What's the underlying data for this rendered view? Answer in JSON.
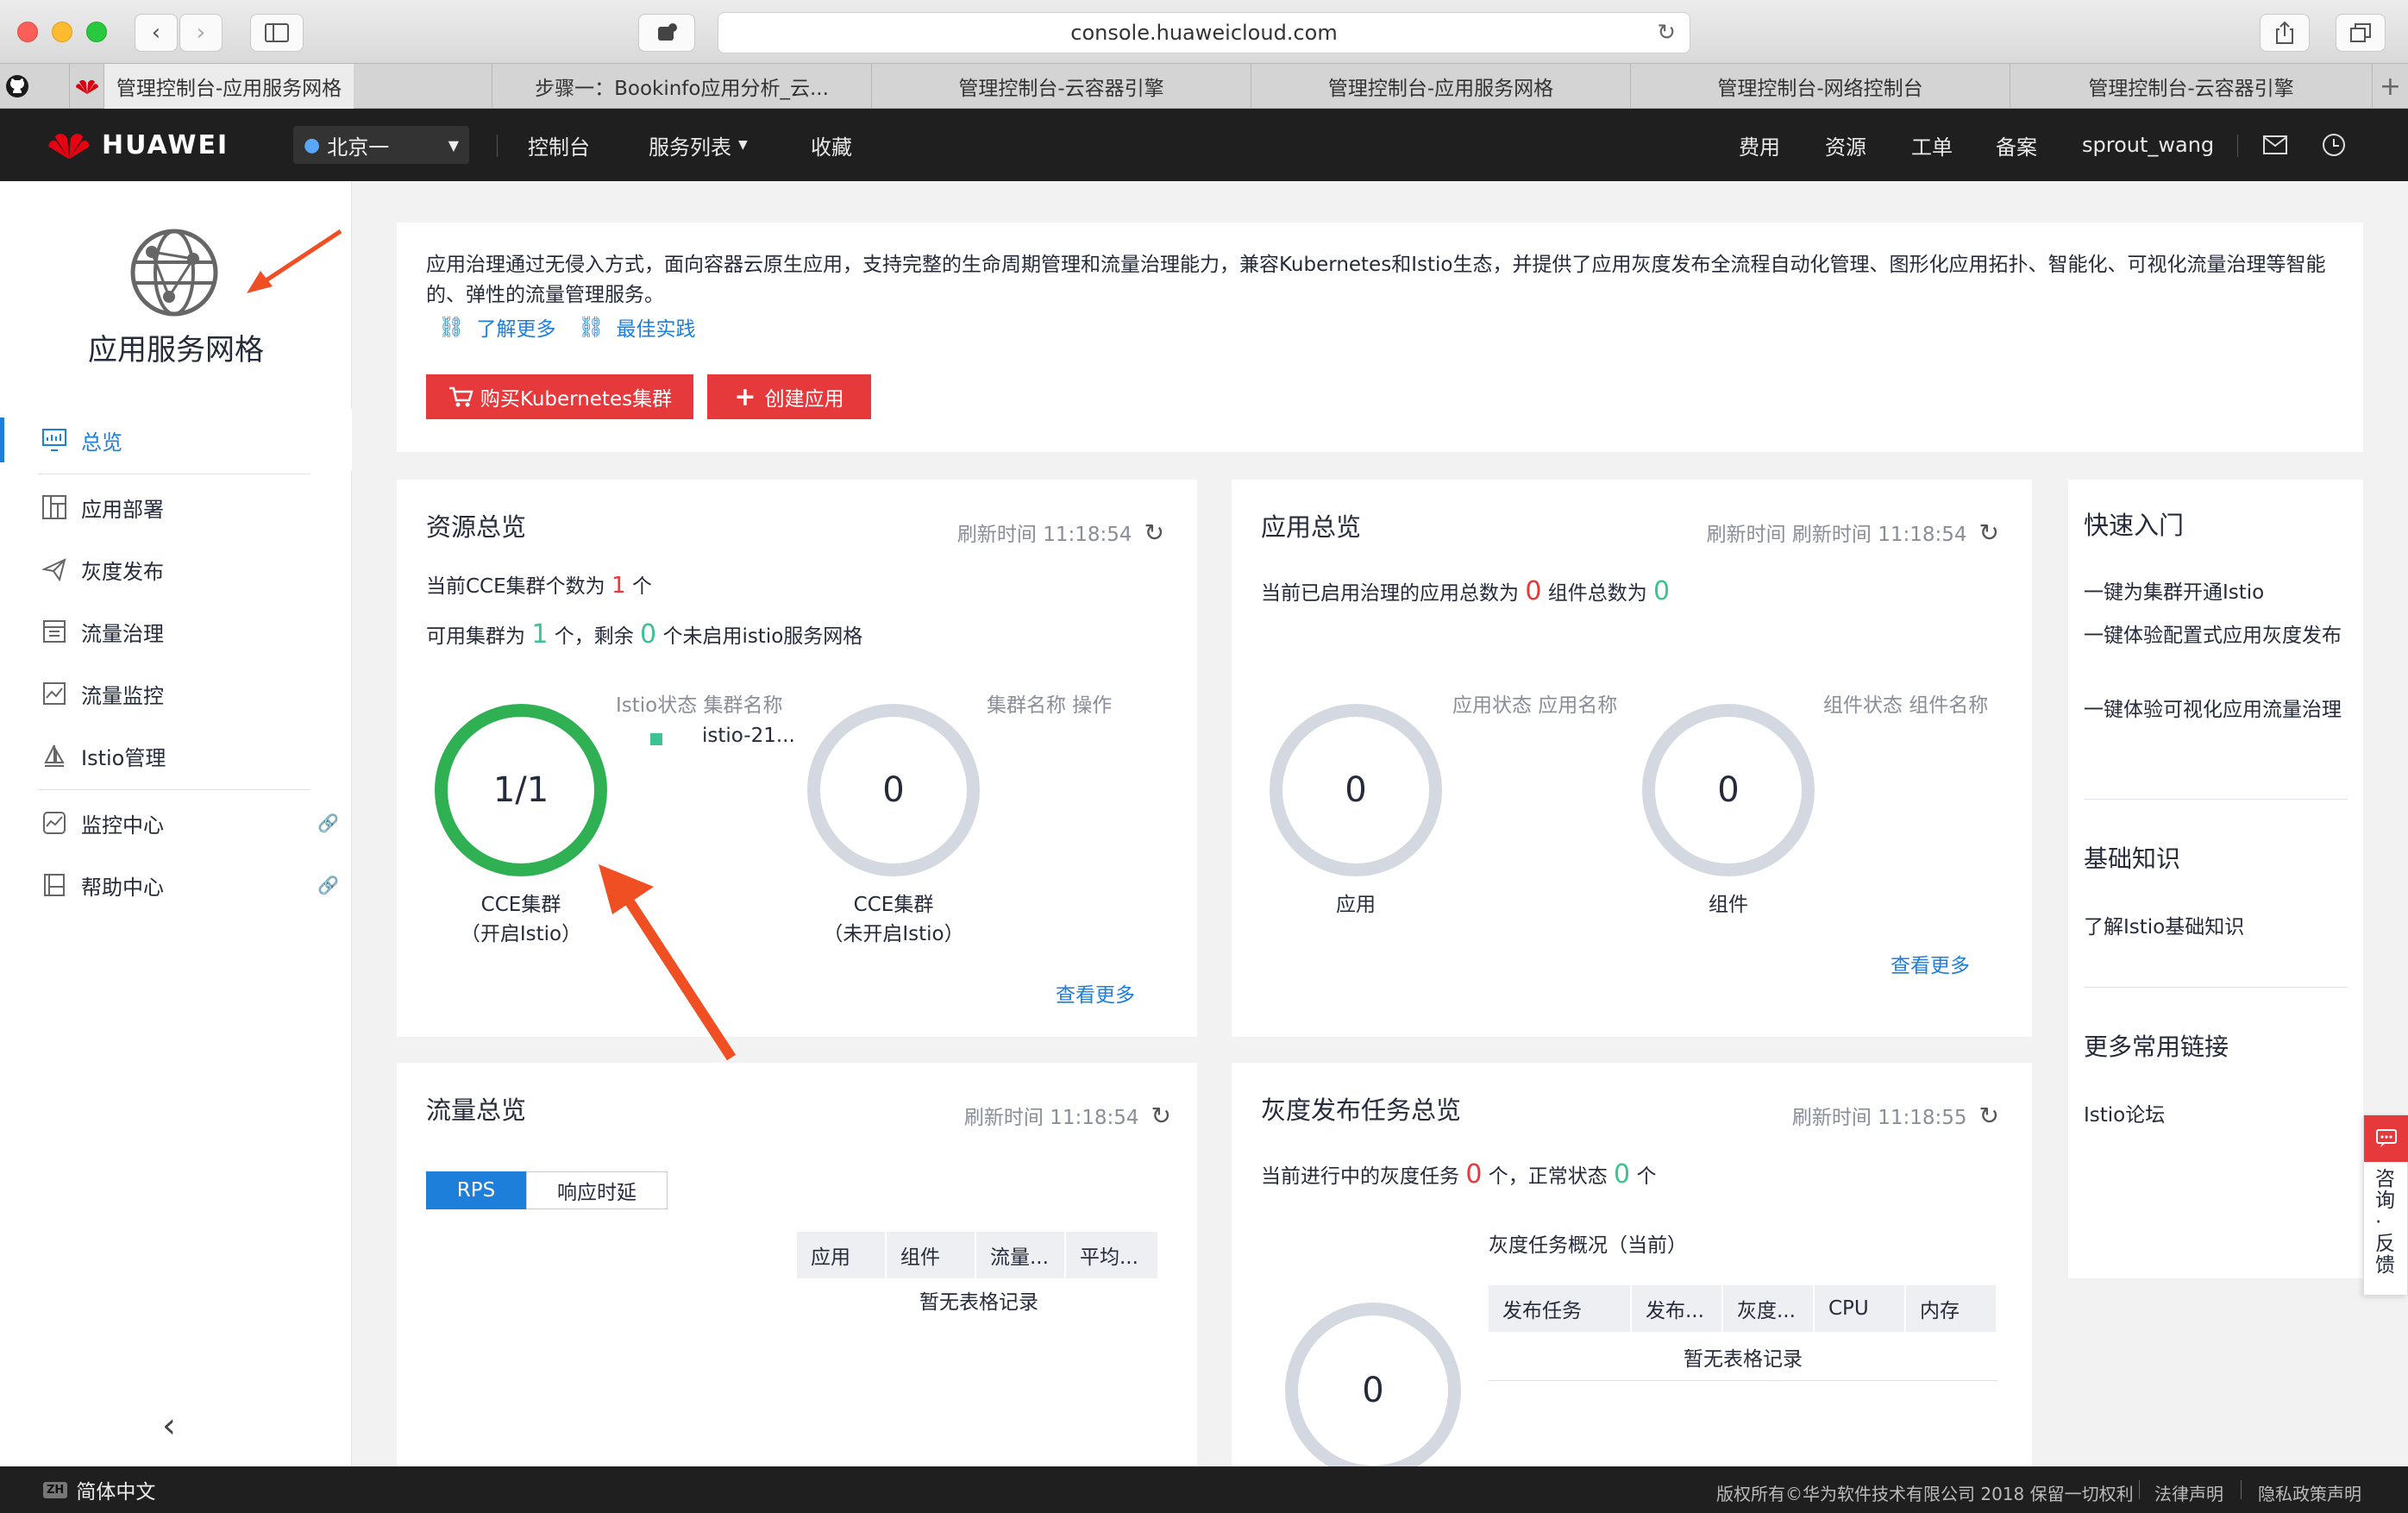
{
  "browser": {
    "url": "console.huaweicloud.com",
    "tabs": [
      {
        "label": "管理控制台-应用服务网格",
        "active": true
      },
      {
        "label": "步骤一：Bookinfo应用分析_云..."
      },
      {
        "label": "管理控制台-云容器引擎"
      },
      {
        "label": "管理控制台-应用服务网格"
      },
      {
        "label": "管理控制台-网络控制台"
      },
      {
        "label": "管理控制台-云容器引擎"
      }
    ],
    "new_tab": "+"
  },
  "header": {
    "brand": "HUAWEI",
    "region": "北京一",
    "nav": [
      "控制台",
      "服务列表",
      "收藏"
    ],
    "right": [
      "费用",
      "资源",
      "工单",
      "备案"
    ],
    "user": "sprout_wang"
  },
  "sidebar": {
    "service_name": "应用服务网格",
    "items": [
      {
        "label": "总览",
        "icon": "overview-icon",
        "active": true
      },
      {
        "label": "应用部署",
        "icon": "deploy-icon"
      },
      {
        "label": "灰度发布",
        "icon": "paper-plane-icon"
      },
      {
        "label": "流量治理",
        "icon": "traffic-gov-icon"
      },
      {
        "label": "流量监控",
        "icon": "traffic-monitor-icon"
      },
      {
        "label": "Istio管理",
        "icon": "istio-icon"
      },
      {
        "label": "监控中心",
        "icon": "monitor-center-icon",
        "link": true
      },
      {
        "label": "帮助中心",
        "icon": "help-center-icon",
        "link": true
      }
    ],
    "collapse": "‹"
  },
  "intro": {
    "text": "应用治理通过无侵入方式，面向容器云原生应用，支持完整的生命周期管理和流量治理能力，兼容Kubernetes和Istio生态，并提供了应用灰度发布全流程自动化管理、图形化应用拓扑、智能化、可视化流量治理等智能的、弹性的流量管理服务。",
    "link_more": "了解更多",
    "link_best": "最佳实践",
    "btn_buy": "购买Kubernetes集群",
    "btn_create": "创建应用"
  },
  "resource": {
    "title": "资源总览",
    "refresh": "刷新时间 11:18:54",
    "cce_prefix": "当前CCE集群个数为",
    "cce_count": "1",
    "cce_suffix": "个",
    "avail_prefix": "可用集群为",
    "avail_count": "1",
    "avail_mid": "个，剩余",
    "remain_count": "0",
    "avail_suffix": "个未启用istio服务网格",
    "col1": "Istio状态 集群名称",
    "col2": "集群名称 操作",
    "cluster_name": "istio-21...",
    "ring1_value": "1/1",
    "ring1_label1": "CCE集群",
    "ring1_label2": "（开启Istio）",
    "ring2_value": "0",
    "ring2_label1": "CCE集群",
    "ring2_label2": "（未开启Istio）",
    "more": "查看更多"
  },
  "app": {
    "title": "应用总览",
    "refresh": "刷新时间 刷新时间 11:18:54",
    "stat_prefix": "当前已启用治理的应用总数为",
    "app_count": "0",
    "stat_mid": "组件总数为",
    "comp_count": "0",
    "col1": "应用状态 应用名称",
    "col2": "组件状态 组件名称",
    "ring1_value": "0",
    "ring1_label": "应用",
    "ring2_value": "0",
    "ring2_label": "组件",
    "more": "查看更多"
  },
  "quick": {
    "title": "快速入门",
    "items": [
      "一键为集群开通Istio",
      "一键体验配置式应用灰度发布",
      "一键体验可视化应用流量治理"
    ],
    "basic_title": "基础知识",
    "basic_items": [
      "了解Istio基础知识"
    ],
    "links_title": "更多常用链接",
    "links_items": [
      "Istio论坛"
    ]
  },
  "traffic": {
    "title": "流量总览",
    "refresh": "刷新时间 11:18:54",
    "tab_rps": "RPS",
    "tab_latency": "响应时延",
    "columns": [
      "应用",
      "组件",
      "流量...",
      "平均..."
    ],
    "empty": "暂无表格记录"
  },
  "gray": {
    "title": "灰度发布任务总览",
    "refresh": "刷新时间 11:18:55",
    "stat_prefix": "当前进行中的灰度任务",
    "running": "0",
    "stat_mid": "个，正常状态",
    "normal": "0",
    "stat_suffix": "个",
    "sub_title": "灰度任务概况（当前）",
    "columns": [
      "发布任务",
      "发布...",
      "灰度...",
      "CPU",
      "内存"
    ],
    "empty": "暂无表格记录",
    "ring_value": "0"
  },
  "feedback": {
    "text": "咨询·反馈"
  },
  "footer": {
    "lang": "简体中文",
    "lang_badge": "ZH",
    "copyright": "版权所有©华为软件技术有限公司 2018 保留一切权利",
    "legal": "法律声明",
    "privacy": "隐私政策声明"
  },
  "colors": {
    "accent": "#e6393c",
    "link": "#1e7fda",
    "green": "#2fb153",
    "header": "#1f1f1f"
  }
}
